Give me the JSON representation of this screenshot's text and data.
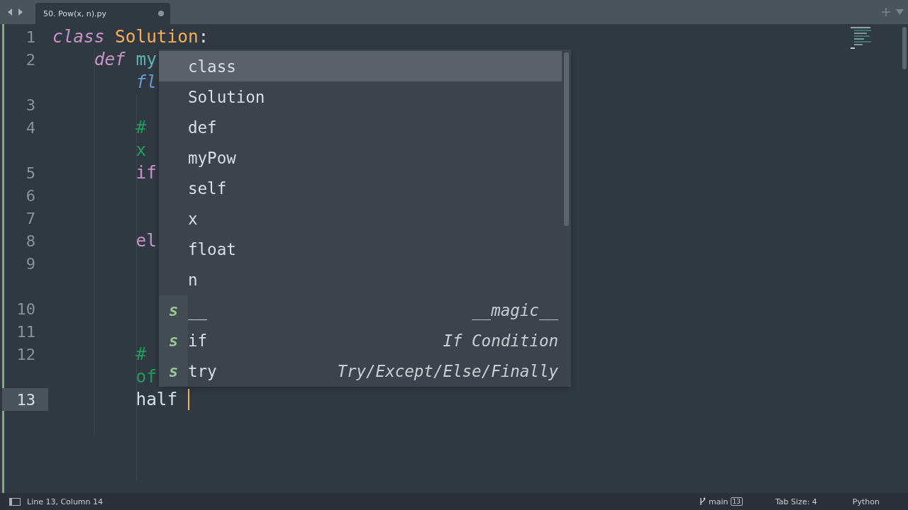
{
  "tabs": [
    {
      "title": "50. Pow(x, n).py",
      "selected": true,
      "dirty": true
    }
  ],
  "code": {
    "lines": [
      {
        "number": "1",
        "active": false,
        "tokens": [
          {
            "text": "class ",
            "kind": "keyword"
          },
          {
            "text": "Solution",
            "kind": "classname"
          },
          {
            "text": ":",
            "kind": "plain"
          }
        ]
      },
      {
        "number": "2",
        "active": false,
        "tokens": [
          {
            "text": "    def ",
            "kind": "keyword"
          },
          {
            "text": "my",
            "kind": "function"
          }
        ]
      },
      {
        "active": false,
        "tokens": [
          {
            "text": "        fl",
            "kind": "type"
          }
        ]
      },
      {
        "number": "3",
        "active": false
      },
      {
        "number": "4",
        "active": false,
        "tokens": [
          {
            "text": "        #",
            "kind": "comment"
          }
        ]
      },
      {
        "active": false,
        "tokens": [
          {
            "text": "        x",
            "kind": "comment"
          }
        ]
      },
      {
        "number": "5",
        "active": false,
        "tokens": [
          {
            "text": "        if",
            "kind": "control"
          }
        ]
      },
      {
        "number": "6",
        "active": false
      },
      {
        "number": "7",
        "active": false
      },
      {
        "number": "8",
        "active": false,
        "tokens": [
          {
            "text": "        el",
            "kind": "control"
          }
        ]
      },
      {
        "number": "9",
        "active": false
      },
      {
        "active": false
      },
      {
        "number": "10",
        "active": false
      },
      {
        "number": "11",
        "active": false
      },
      {
        "number": "12",
        "active": false,
        "tokens": [
          {
            "text": "        #",
            "kind": "comment"
          }
        ]
      },
      {
        "active": false,
        "tokens": [
          {
            "text": "        of",
            "kind": "comment"
          }
        ]
      },
      {
        "number": "13",
        "active": true,
        "tokens": [
          {
            "text": "        half ",
            "kind": "plain"
          }
        ]
      }
    ]
  },
  "completions": [
    {
      "label": "class",
      "selected": true
    },
    {
      "label": "Solution",
      "selected": false
    },
    {
      "label": "def",
      "selected": false
    },
    {
      "label": "myPow",
      "selected": false
    },
    {
      "label": "self",
      "selected": false
    },
    {
      "label": "x",
      "selected": false
    },
    {
      "label": "float",
      "selected": false
    },
    {
      "label": "n",
      "selected": false
    },
    {
      "label": "__",
      "selected": false,
      "kind": "snippet",
      "badge": "s",
      "hint": "__magic__"
    },
    {
      "label": "if",
      "selected": false,
      "kind": "snippet",
      "badge": "s",
      "hint": "If Condition"
    },
    {
      "label": "try",
      "selected": false,
      "kind": "snippet",
      "badge": "s",
      "hint": "Try/Except/Else/Finally"
    }
  ],
  "status_bar": {
    "position": "Line 13, Column 14",
    "branch": "main",
    "changes": "13",
    "tab_size": "Tab Size: 4",
    "syntax": "Python"
  }
}
